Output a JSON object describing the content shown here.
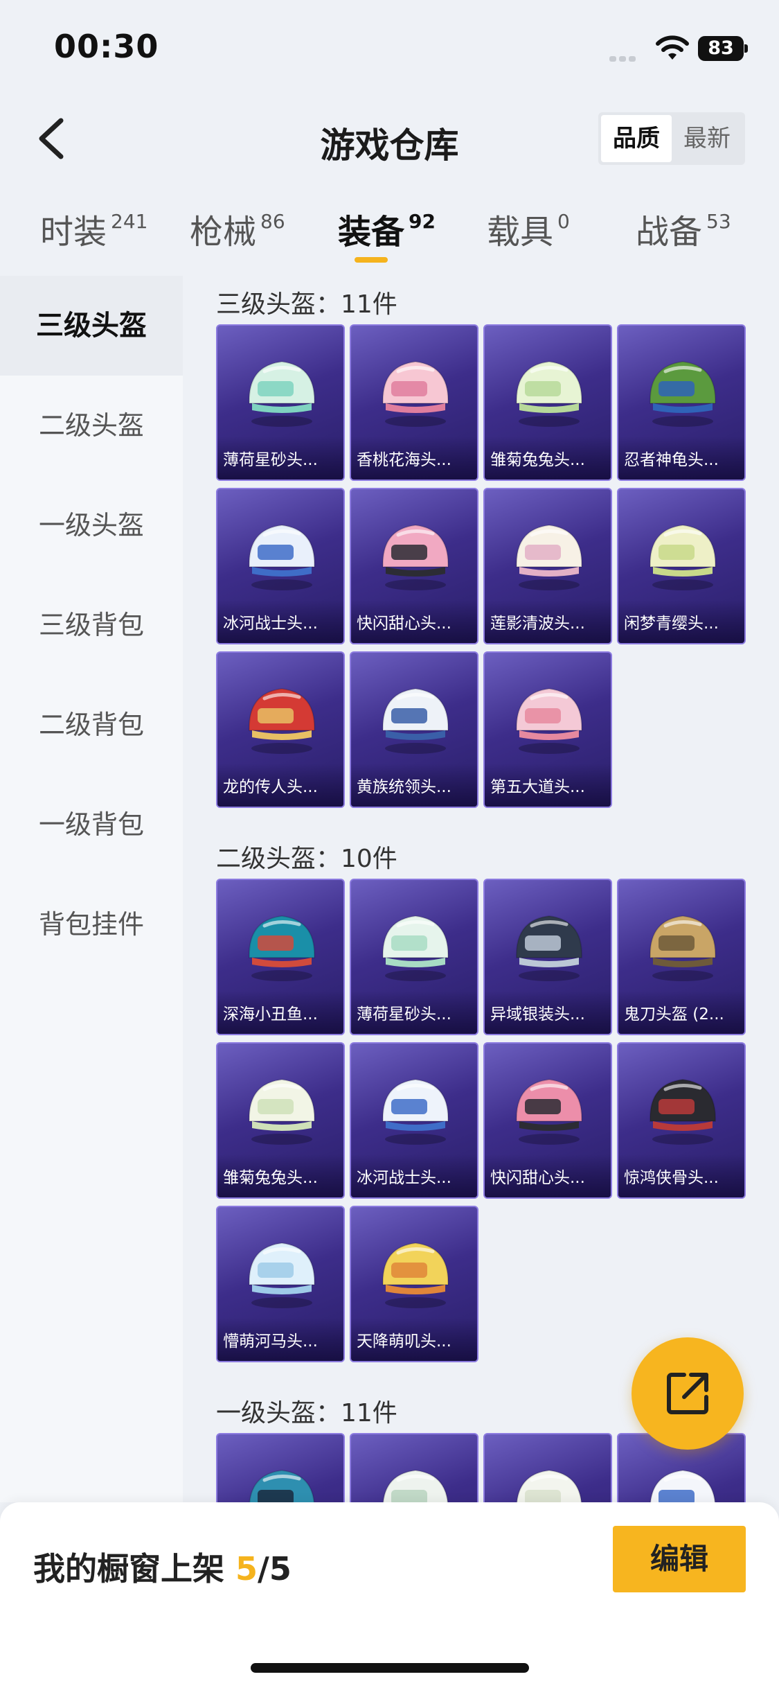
{
  "status": {
    "time": "00:30",
    "battery": "83"
  },
  "header": {
    "title": "游戏仓库",
    "sort_options": [
      "品质",
      "最新"
    ],
    "active_sort": "品质"
  },
  "tabs": [
    {
      "label": "时装",
      "count": "241"
    },
    {
      "label": "枪械",
      "count": "86"
    },
    {
      "label": "装备",
      "count": "92"
    },
    {
      "label": "载具",
      "count": "0"
    },
    {
      "label": "战备",
      "count": "53"
    }
  ],
  "sidebar": {
    "items": [
      "三级头盔",
      "二级头盔",
      "一级头盔",
      "三级背包",
      "二级背包",
      "一级背包",
      "背包挂件"
    ],
    "active": "三级头盔"
  },
  "sections": [
    {
      "title": "三级头盔：11件",
      "items": [
        {
          "name": "薄荷星砂头...",
          "colors": [
            "#d6f1e4",
            "#7fd3c0"
          ]
        },
        {
          "name": "香桃花海头...",
          "colors": [
            "#f7c7d3",
            "#e07e9e"
          ]
        },
        {
          "name": "雏菊兔兔头...",
          "colors": [
            "#e7f4d4",
            "#b7d99a"
          ]
        },
        {
          "name": "忍者神龟头...",
          "colors": [
            "#5b9a3e",
            "#2f63b8"
          ]
        },
        {
          "name": "冰河战士头...",
          "colors": [
            "#e9f0fb",
            "#3f6dc8"
          ]
        },
        {
          "name": "快闪甜心头...",
          "colors": [
            "#f1a9c2",
            "#2c2c34"
          ]
        },
        {
          "name": "莲影清波头...",
          "colors": [
            "#f7f1e6",
            "#e3b0c6"
          ]
        },
        {
          "name": "闲梦青缨头...",
          "colors": [
            "#eef0c7",
            "#c8d98a"
          ]
        },
        {
          "name": "龙的传人头...",
          "colors": [
            "#d43a34",
            "#e8c064"
          ]
        },
        {
          "name": "黄族统领头...",
          "colors": [
            "#eef2f8",
            "#3a5fa8"
          ]
        },
        {
          "name": "第五大道头...",
          "colors": [
            "#f4c9d6",
            "#e6899f"
          ]
        }
      ]
    },
    {
      "title": "二级头盔：10件",
      "items": [
        {
          "name": "深海小丑鱼...",
          "colors": [
            "#1a8fa8",
            "#d14b3c"
          ]
        },
        {
          "name": "薄荷星砂头...",
          "colors": [
            "#e6f4ec",
            "#a8dcc4"
          ]
        },
        {
          "name": "异域银装头...",
          "colors": [
            "#2f3a4c",
            "#bcc8d6"
          ]
        },
        {
          "name": "鬼刀头盔 (2...",
          "colors": [
            "#c9a566",
            "#6e5a3a"
          ]
        },
        {
          "name": "雏菊兔兔头...",
          "colors": [
            "#f2f5e6",
            "#cfe0b8"
          ]
        },
        {
          "name": "冰河战士头...",
          "colors": [
            "#eef3fb",
            "#3f6dc8"
          ]
        },
        {
          "name": "快闪甜心头...",
          "colors": [
            "#ec8eaa",
            "#2c2c34"
          ]
        },
        {
          "name": "惊鸿侠骨头...",
          "colors": [
            "#2a2a30",
            "#b83a3a"
          ]
        },
        {
          "name": "懵萌河马头...",
          "colors": [
            "#dff0fb",
            "#9fcbe8"
          ]
        },
        {
          "name": "天降萌叽头...",
          "colors": [
            "#f2d35a",
            "#e0863a"
          ]
        }
      ]
    },
    {
      "title": "一级头盔：11件",
      "items": [
        {
          "name": "",
          "colors": [
            "#2e8fb0",
            "#1a2a40"
          ]
        },
        {
          "name": "",
          "colors": [
            "#eef3ee",
            "#b8d4c0"
          ]
        },
        {
          "name": "",
          "colors": [
            "#f3f5ee",
            "#d8e0cc"
          ]
        },
        {
          "name": "",
          "colors": [
            "#f4f6fb",
            "#3f6dc8"
          ]
        }
      ]
    }
  ],
  "bottom": {
    "label": "我的橱窗上架",
    "count": "5",
    "total": "/5",
    "edit_label": "编辑"
  }
}
